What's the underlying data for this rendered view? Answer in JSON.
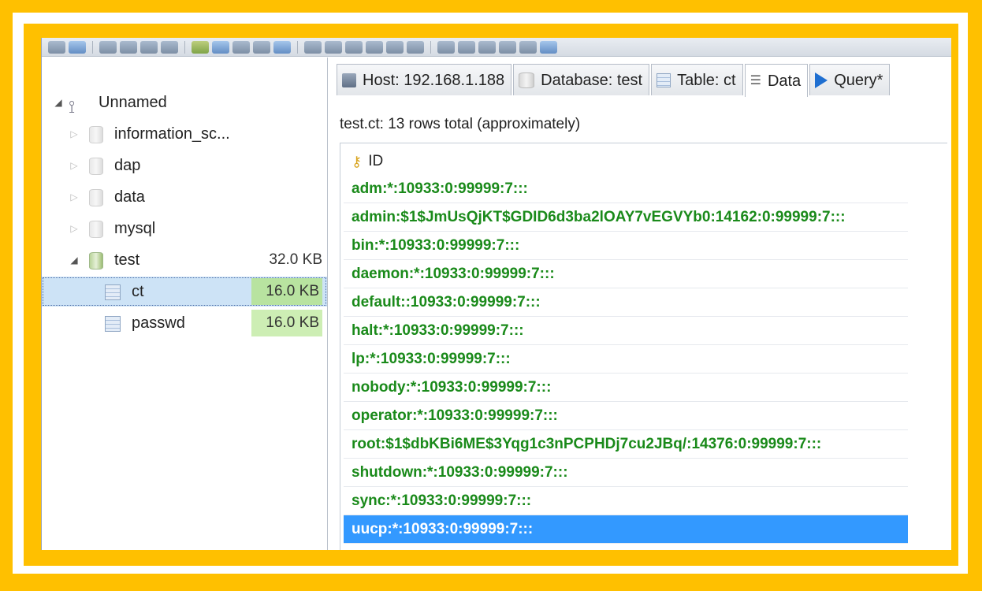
{
  "tree": {
    "connection": "Unnamed",
    "databases": [
      {
        "name": "information_sc..."
      },
      {
        "name": "dap"
      },
      {
        "name": "data"
      },
      {
        "name": "mysql"
      },
      {
        "name": "test",
        "size": "32.0 KB"
      }
    ],
    "tables": [
      {
        "name": "ct",
        "size": "16.0 KB"
      },
      {
        "name": "passwd",
        "size": "16.0 KB"
      }
    ]
  },
  "tabs": [
    {
      "label": "Host: 192.168.1.188",
      "icon": "host-icon"
    },
    {
      "label": "Database: test",
      "icon": "database-icon"
    },
    {
      "label": "Table: ct",
      "icon": "table-icon"
    },
    {
      "label": "Data",
      "icon": "data-grid-icon"
    },
    {
      "label": "Query*",
      "icon": "query-play-icon"
    }
  ],
  "status": "test.ct: 13 rows total (approximately)",
  "grid": {
    "column": "ID",
    "rows": [
      "adm:*:10933:0:99999:7:::",
      "admin:$1$JmUsQjKT$GDID6d3ba2lOAY7vEGVYb0:14162:0:99999:7:::",
      "bin:*:10933:0:99999:7:::",
      "daemon:*:10933:0:99999:7:::",
      "default::10933:0:99999:7:::",
      "halt:*:10933:0:99999:7:::",
      "lp:*:10933:0:99999:7:::",
      "nobody:*:10933:0:99999:7:::",
      "operator:*:10933:0:99999:7:::",
      "root:$1$dbKBi6ME$3Yqg1c3nPCPHDj7cu2JBq/:14376:0:99999:7:::",
      "shutdown:*:10933:0:99999:7:::",
      "sync:*:10933:0:99999:7:::",
      "uucp:*:10933:0:99999:7:::"
    ]
  },
  "colors": {
    "frame": "#ffc000",
    "row_text": "#1a8a1a",
    "selection": "#3399ff"
  }
}
